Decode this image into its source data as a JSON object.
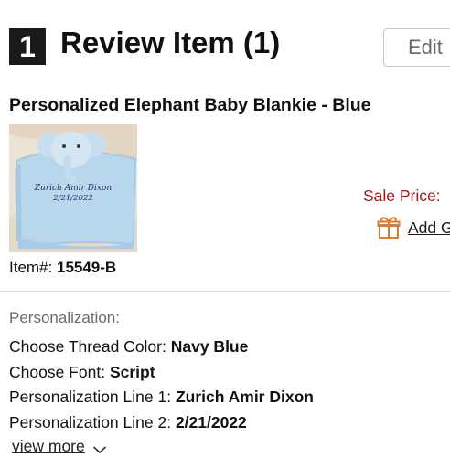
{
  "header": {
    "step_number": "1",
    "title": "Review Item (1)",
    "edit_label": "Edit"
  },
  "product": {
    "title": "Personalized Elephant Baby Blankie - Blue",
    "image_text_line1": "Zurich Amir Dixon",
    "image_text_line2": "2/21/2022",
    "item_label": "Item#:",
    "item_number": "15549-B",
    "sale_price_label": "Sale Price:",
    "add_gift_label": "Add Gift Wrap"
  },
  "personalization": {
    "heading": "Personalization:",
    "rows": [
      {
        "label": "Choose Thread Color:",
        "value": "Navy Blue"
      },
      {
        "label": "Choose Font:",
        "value": "Script"
      },
      {
        "label": "Personalization Line 1:",
        "value": "Zurich Amir Dixon"
      },
      {
        "label": "Personalization Line 2:",
        "value": "2/21/2022"
      }
    ],
    "view_more_label": "view more"
  },
  "icons": {
    "gift": "gift-icon",
    "chevron": "chevron-down-icon"
  },
  "colors": {
    "sale_price": "#a31c1c",
    "gift_icon": "#e07b2a",
    "step_badge": "#1a1a1a"
  }
}
